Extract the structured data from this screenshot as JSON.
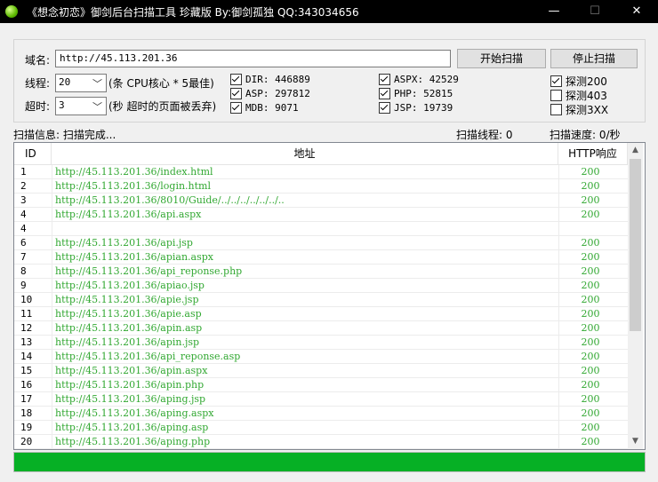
{
  "window": {
    "title": "《想念初恋》御剑后台扫描工具 珍藏版 By:御剑孤独 QQ:343034656",
    "minimize": "—",
    "maximize": "☐",
    "close": "✕"
  },
  "form": {
    "domain_label": "域名:",
    "domain_value": "http://45.113.201.36",
    "threads_label": "线程:",
    "threads_value": "20",
    "threads_hint": "(条 CPU核心 * 5最佳)",
    "timeout_label": "超时:",
    "timeout_value": "3",
    "timeout_hint": "(秒 超时的页面被丢弃)",
    "start_button": "开始扫描",
    "stop_button": "停止扫描"
  },
  "dictionaries": [
    {
      "label": "DIR: 446889",
      "checked": true
    },
    {
      "label": "ASP: 297812",
      "checked": true
    },
    {
      "label": "MDB: 9071",
      "checked": true
    },
    {
      "label": "ASPX: 42529",
      "checked": true
    },
    {
      "label": "PHP: 52815",
      "checked": true
    },
    {
      "label": "JSP: 19739",
      "checked": true
    }
  ],
  "probes": [
    {
      "label": "探测200",
      "checked": true
    },
    {
      "label": "探测403",
      "checked": false
    },
    {
      "label": "探测3XX",
      "checked": false
    }
  ],
  "status": {
    "info": "扫描信息: 扫描完成...",
    "threads": "扫描线程: 0",
    "speed": "扫描速度: 0/秒"
  },
  "table": {
    "columns": [
      "ID",
      "地址",
      "HTTP响应"
    ],
    "rows": [
      {
        "id": "1",
        "url": "http://45.113.201.36/index.html",
        "code": "200"
      },
      {
        "id": "2",
        "url": "http://45.113.201.36/login.html",
        "code": "200"
      },
      {
        "id": "3",
        "url": "http://45.113.201.36/8010/Guide/../../../../../../..",
        "code": "200"
      },
      {
        "id": "4",
        "url": "http://45.113.201.36/api.aspx",
        "code": "200"
      },
      {
        "id": "4",
        "url": "",
        "code": ""
      },
      {
        "id": "6",
        "url": "http://45.113.201.36/api.jsp",
        "code": "200"
      },
      {
        "id": "7",
        "url": "http://45.113.201.36/apian.aspx",
        "code": "200"
      },
      {
        "id": "8",
        "url": "http://45.113.201.36/api_reponse.php",
        "code": "200"
      },
      {
        "id": "9",
        "url": "http://45.113.201.36/apiao.jsp",
        "code": "200"
      },
      {
        "id": "10",
        "url": "http://45.113.201.36/apie.jsp",
        "code": "200"
      },
      {
        "id": "11",
        "url": "http://45.113.201.36/apie.asp",
        "code": "200"
      },
      {
        "id": "12",
        "url": "http://45.113.201.36/apin.asp",
        "code": "200"
      },
      {
        "id": "13",
        "url": "http://45.113.201.36/apin.jsp",
        "code": "200"
      },
      {
        "id": "14",
        "url": "http://45.113.201.36/api_reponse.asp",
        "code": "200"
      },
      {
        "id": "15",
        "url": "http://45.113.201.36/apin.aspx",
        "code": "200"
      },
      {
        "id": "16",
        "url": "http://45.113.201.36/apin.php",
        "code": "200"
      },
      {
        "id": "17",
        "url": "http://45.113.201.36/aping.jsp",
        "code": "200"
      },
      {
        "id": "18",
        "url": "http://45.113.201.36/aping.aspx",
        "code": "200"
      },
      {
        "id": "19",
        "url": "http://45.113.201.36/aping.asp",
        "code": "200"
      },
      {
        "id": "20",
        "url": "http://45.113.201.36/aping.php",
        "code": "200"
      }
    ]
  },
  "progress": {
    "fraction": 1.0,
    "color": "#06b025"
  }
}
